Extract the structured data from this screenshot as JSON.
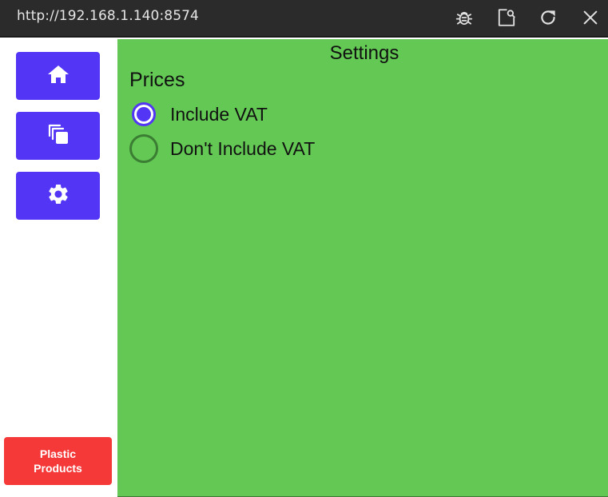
{
  "browser": {
    "url": "http://192.168.1.140:8574",
    "icons": [
      "bug-icon",
      "open-external-icon",
      "reload-icon",
      "close-icon"
    ]
  },
  "sidebar": {
    "items": [
      {
        "name": "home",
        "icon": "home-icon"
      },
      {
        "name": "copy",
        "icon": "copy-icon"
      },
      {
        "name": "settings",
        "icon": "gear-icon"
      }
    ],
    "brand_label": "Plastic Products",
    "colors": {
      "nav": "#5336f5",
      "brand": "#f53838"
    }
  },
  "main": {
    "title": "Settings",
    "section": "Prices",
    "options": [
      {
        "label": "Include VAT",
        "selected": true
      },
      {
        "label": "Don't Include VAT",
        "selected": false
      }
    ],
    "background": "#63c954"
  }
}
